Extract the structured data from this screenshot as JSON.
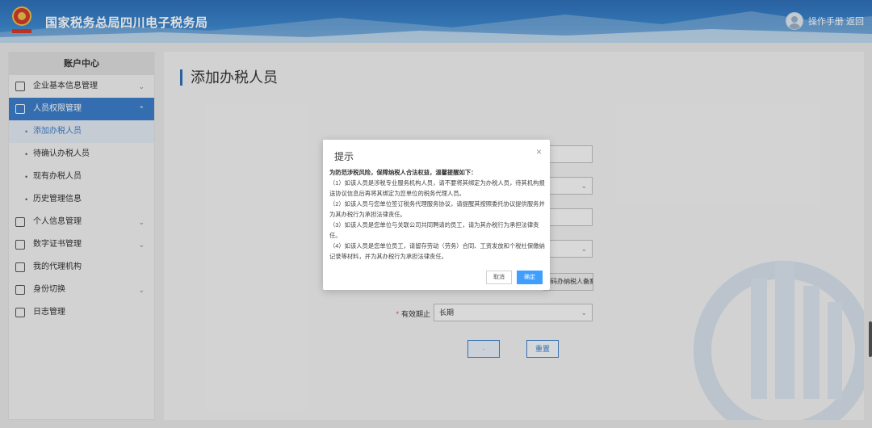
{
  "header": {
    "site_title": "国家税务总局四川电子税务局",
    "user_text": "操作手册  返回"
  },
  "sidebar": {
    "heading": "账户中心",
    "items": [
      {
        "label": "企业基本信息管理",
        "icon": "building-icon"
      },
      {
        "label": "人员权限管理",
        "icon": "person-icon",
        "active": true
      },
      {
        "label": "添加办税人员",
        "sub": true,
        "current": true
      },
      {
        "label": "待确认办税人员",
        "sub": true
      },
      {
        "label": "现有办税人员",
        "sub": true
      },
      {
        "label": "历史管理信息",
        "sub": true
      },
      {
        "label": "个人信息管理",
        "icon": "id-card-icon"
      },
      {
        "label": "数字证书管理",
        "icon": "certificate-icon"
      },
      {
        "label": "我的代理机构",
        "icon": "agency-icon"
      },
      {
        "label": "身份切换",
        "icon": "switch-icon"
      },
      {
        "label": "日志管理",
        "icon": "log-icon"
      }
    ]
  },
  "main": {
    "title": "添加办税人员",
    "scan_button": "扫码办纳税人备案",
    "validity_label": "有效期止",
    "validity_value": "长期",
    "reset_button": "重置",
    "submit_button": "·"
  },
  "modal": {
    "title": "提示",
    "close": "×",
    "lead": "为防范涉税风险，保障纳税人合法权益，温馨提醒如下：",
    "points": [
      "（1）如该人员是涉税专业服务机构人员，请不要将其绑定为办税人员，待其机构报送协议信息后再将其绑定为您单位的税务代理人员。",
      "（2）如该人员与您单位签订税务代理服务协议，请提醒其按照委托协议提供服务并为其办税行为承担法律责任。",
      "（3）如该人员是您单位与关联公司共同聘请的员工，请为其办税行为承担法律责任。",
      "（4）如该人员是您单位员工，请留存劳动（劳务）合同、工资发放和个税社保缴纳记录等材料，并为其办税行为承担法律责任。"
    ],
    "cancel": "取消",
    "ok": "确定"
  }
}
